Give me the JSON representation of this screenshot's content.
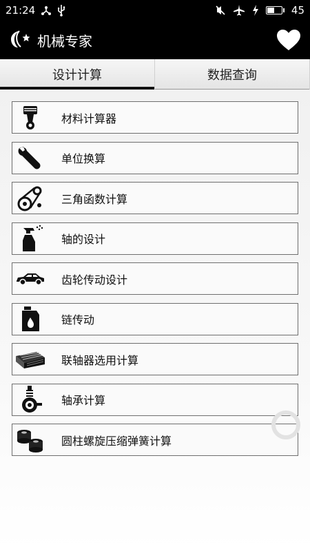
{
  "status_bar": {
    "time": "21:24",
    "battery": "45",
    "battery_fraction": 0.45,
    "icons": [
      "usb-tether-icon",
      "usb-icon",
      "silent-icon",
      "airplane-mode-icon",
      "charging-icon",
      "battery-icon"
    ]
  },
  "app_bar": {
    "title": "机械专家",
    "logo_icon": "moon-star-logo-icon",
    "favorite_icon": "heart-icon"
  },
  "tabs": [
    {
      "label": "设计计算",
      "active": true
    },
    {
      "label": "数据查询",
      "active": false
    }
  ],
  "items": [
    {
      "label": "材料计算器",
      "icon": "piston-icon"
    },
    {
      "label": "单位换算",
      "icon": "wrench-icon"
    },
    {
      "label": "三角函数计算",
      "icon": "belt-drive-icon"
    },
    {
      "label": "轴的设计",
      "icon": "spray-bottle-icon"
    },
    {
      "label": "齿轮传动设计",
      "icon": "car-icon"
    },
    {
      "label": "链传动",
      "icon": "oil-can-icon"
    },
    {
      "label": "联轴器选用计算",
      "icon": "radiator-icon"
    },
    {
      "label": "轴承计算",
      "icon": "wheel-suspension-icon"
    },
    {
      "label": "圆柱螺旋压缩弹簧计算",
      "icon": "oil-filter-icon"
    }
  ]
}
